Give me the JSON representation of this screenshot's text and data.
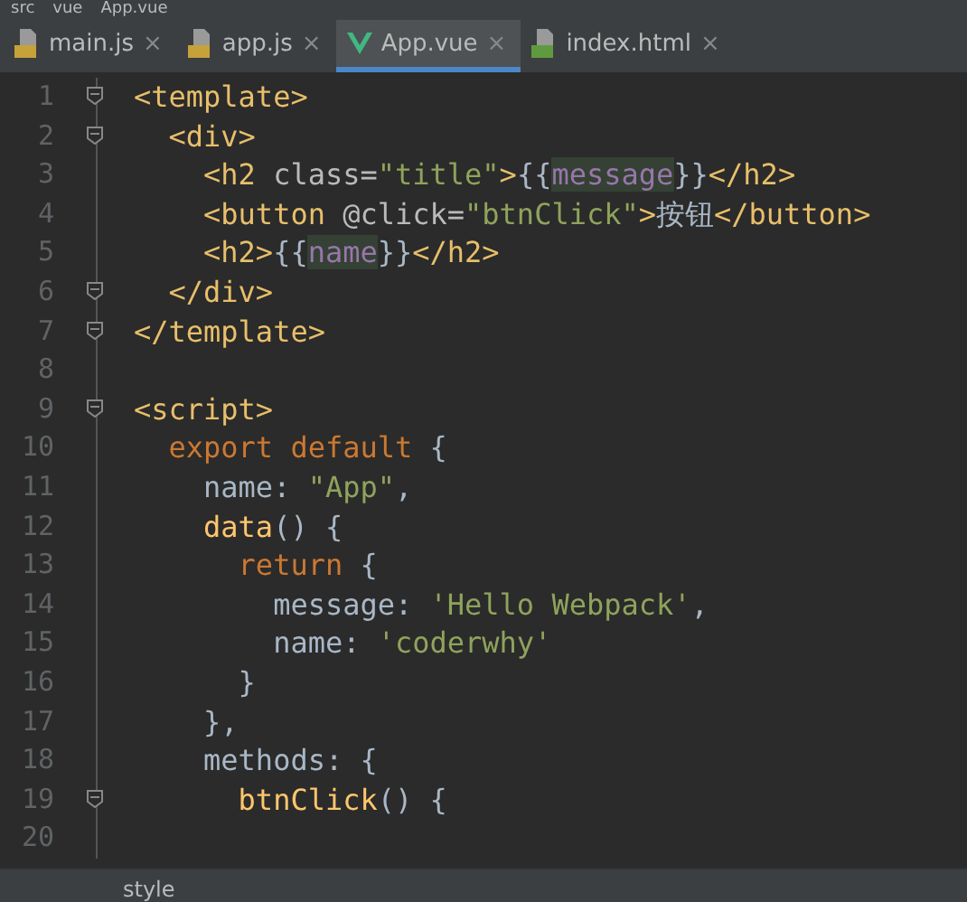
{
  "breadcrumb": [
    "src",
    "vue",
    "App.vue"
  ],
  "tabs": [
    {
      "label": "main.js",
      "kind": "js",
      "selected": false,
      "close": "×"
    },
    {
      "label": "app.js",
      "kind": "js",
      "selected": false,
      "close": "×"
    },
    {
      "label": "App.vue",
      "kind": "vue",
      "selected": true,
      "close": "×"
    },
    {
      "label": "index.html",
      "kind": "html",
      "selected": false,
      "close": "×"
    }
  ],
  "lines": [
    {
      "number": "1",
      "fold": true,
      "tokens": [
        {
          "kind": "tag",
          "text": "<template>"
        }
      ]
    },
    {
      "number": "2",
      "fold": true,
      "tokens": [
        {
          "kind": "tag",
          "text": "  <div>"
        }
      ]
    },
    {
      "number": "3",
      "fold": false,
      "tokens": [
        {
          "kind": "tag",
          "text": "    <h2 "
        },
        {
          "kind": "attr",
          "text": "class="
        },
        {
          "kind": "string",
          "text": "\"title\""
        },
        {
          "kind": "tag",
          "text": ">"
        },
        {
          "kind": "plain",
          "text": "{{"
        },
        {
          "kind": "highlight",
          "text": "message"
        },
        {
          "kind": "plain",
          "text": "}}"
        },
        {
          "kind": "tag",
          "text": "</h2>"
        }
      ]
    },
    {
      "number": "4",
      "fold": false,
      "tokens": [
        {
          "kind": "tag",
          "text": "    <button "
        },
        {
          "kind": "attr",
          "text": "@click="
        },
        {
          "kind": "string",
          "text": "\"btnClick\""
        },
        {
          "kind": "tag",
          "text": ">"
        },
        {
          "kind": "plain",
          "text": "按钮"
        },
        {
          "kind": "tag",
          "text": "</button>"
        }
      ]
    },
    {
      "number": "5",
      "fold": false,
      "tokens": [
        {
          "kind": "tag",
          "text": "    <h2>"
        },
        {
          "kind": "plain",
          "text": "{{"
        },
        {
          "kind": "highlight",
          "text": "name"
        },
        {
          "kind": "plain",
          "text": "}}"
        },
        {
          "kind": "tag",
          "text": "</h2>"
        }
      ]
    },
    {
      "number": "6",
      "fold": true,
      "tokens": [
        {
          "kind": "tag",
          "text": "  </div>"
        }
      ]
    },
    {
      "number": "7",
      "fold": true,
      "tokens": [
        {
          "kind": "tag",
          "text": "</template>"
        }
      ]
    },
    {
      "number": "8",
      "fold": false
    },
    {
      "number": "9",
      "fold": true,
      "tokens": [
        {
          "kind": "tag",
          "text": "<script>"
        }
      ]
    },
    {
      "number": "10",
      "fold": false,
      "tokens": [
        {
          "kind": "keyword",
          "text": "  export default"
        },
        {
          "kind": "plain",
          "text": " {"
        }
      ]
    },
    {
      "number": "11",
      "fold": false,
      "tokens": [
        {
          "kind": "plain",
          "text": "    name: "
        },
        {
          "kind": "string",
          "text": "\"App\""
        },
        {
          "kind": "plain",
          "text": ","
        }
      ]
    },
    {
      "number": "12",
      "fold": false,
      "tokens": [
        {
          "kind": "function",
          "text": "    data"
        },
        {
          "kind": "plain",
          "text": "() {"
        }
      ]
    },
    {
      "number": "13",
      "fold": false,
      "tokens": [
        {
          "kind": "keyword",
          "text": "      return"
        },
        {
          "kind": "plain",
          "text": " {"
        }
      ]
    },
    {
      "number": "14",
      "fold": false,
      "tokens": [
        {
          "kind": "plain",
          "text": "        message: "
        },
        {
          "kind": "string",
          "text": "'Hello Webpack'"
        },
        {
          "kind": "plain",
          "text": ","
        }
      ]
    },
    {
      "number": "15",
      "fold": false,
      "tokens": [
        {
          "kind": "plain",
          "text": "        name: "
        },
        {
          "kind": "string",
          "text": "'coderwhy'"
        }
      ]
    },
    {
      "number": "16",
      "fold": false,
      "tokens": [
        {
          "kind": "plain",
          "text": "      }"
        }
      ]
    },
    {
      "number": "17",
      "fold": false,
      "tokens": [
        {
          "kind": "plain",
          "text": "    },"
        }
      ]
    },
    {
      "number": "18",
      "fold": false,
      "tokens": [
        {
          "kind": "plain",
          "text": "    methods: {"
        }
      ]
    },
    {
      "number": "19",
      "fold": true,
      "tokens": [
        {
          "kind": "function",
          "text": "      btnClick"
        },
        {
          "kind": "plain",
          "text": "() {"
        }
      ]
    },
    {
      "number": "20",
      "fold": false
    }
  ],
  "status_bar": {
    "text": "style"
  }
}
